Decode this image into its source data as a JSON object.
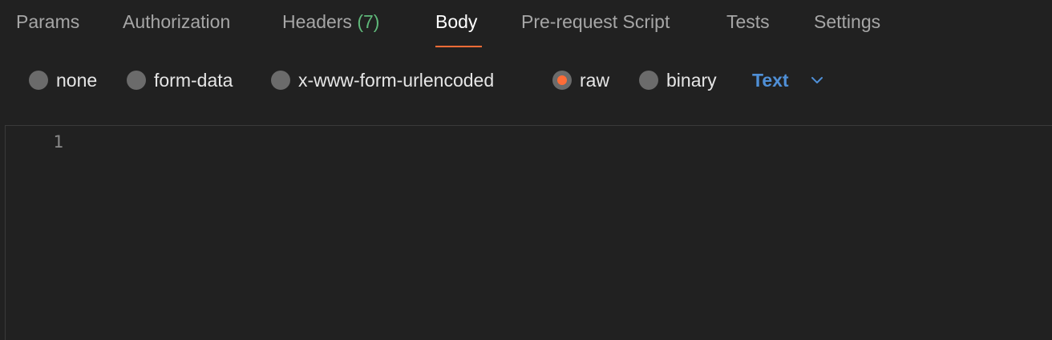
{
  "tabs": [
    {
      "label": "Params"
    },
    {
      "label": "Authorization"
    },
    {
      "label": "Headers",
      "count": "(7)"
    },
    {
      "label": "Body",
      "active": true
    },
    {
      "label": "Pre-request Script"
    },
    {
      "label": "Tests"
    },
    {
      "label": "Settings"
    }
  ],
  "body_types": [
    {
      "label": "none",
      "checked": false
    },
    {
      "label": "form-data",
      "checked": false
    },
    {
      "label": "x-www-form-urlencoded",
      "checked": false
    },
    {
      "label": "raw",
      "checked": true
    },
    {
      "label": "binary",
      "checked": false
    }
  ],
  "raw_language": {
    "selected": "Text",
    "icon": "chevron-down-icon"
  },
  "editor": {
    "line_numbers": [
      "1"
    ],
    "content": ""
  },
  "colors": {
    "background": "#212121",
    "active_tab_underline": "#ff6c37",
    "headers_count": "#5fb87a",
    "language_select": "#4f8fd6",
    "radio_checked": "#ff6c37"
  }
}
